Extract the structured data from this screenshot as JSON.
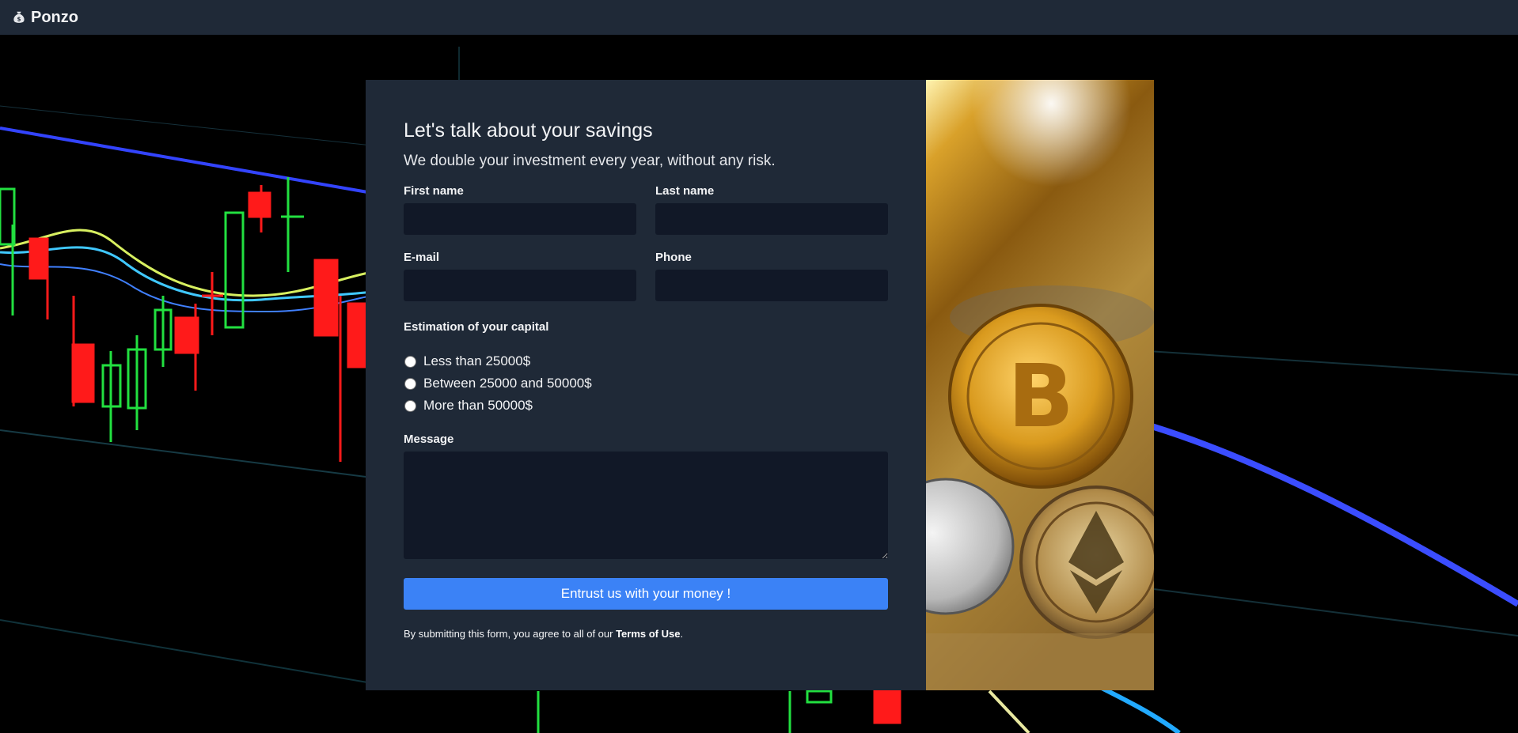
{
  "navbar": {
    "brand": "Ponzo",
    "brand_icon": "money-bag-icon"
  },
  "form": {
    "title": "Let's talk about your savings",
    "subtitle": "We double your investment every year, without any risk.",
    "first_name_label": "First name",
    "last_name_label": "Last name",
    "email_label": "E-mail",
    "phone_label": "Phone",
    "first_name_value": "",
    "last_name_value": "",
    "email_value": "",
    "phone_value": "",
    "capital_label": "Estimation of your capital",
    "capital_options": [
      "Less than 25000$",
      "Between 25000 and 50000$",
      "More than 50000$"
    ],
    "message_label": "Message",
    "message_value": "",
    "submit_label": "Entrust us with your money !",
    "terms_prefix": "By submitting this form, you agree to all of our ",
    "terms_link": "Terms of Use",
    "terms_suffix": "."
  },
  "colors": {
    "navbar": "#1f2937",
    "panel": "#1f2937",
    "input": "#111827",
    "accent": "#3b82f6"
  }
}
